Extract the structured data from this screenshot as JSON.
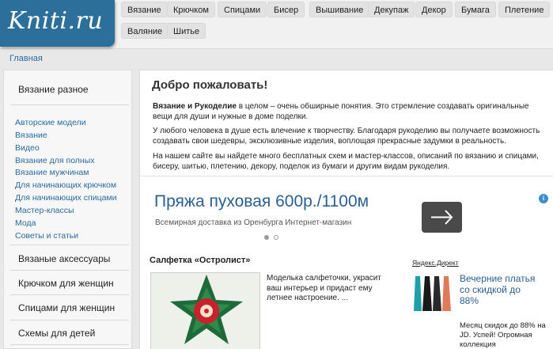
{
  "logo": {
    "text": "Kniti.ru"
  },
  "top_menu": [
    "Вязание",
    "Крючком",
    "Спицами",
    "Бисер",
    "Вышивание",
    "Декупаж",
    "Декор",
    "Бумага",
    "Плетение",
    "Валяние",
    "Шитье"
  ],
  "breadcrumb": {
    "home": "Главная"
  },
  "sidebar": {
    "sections": [
      "Вязание разное",
      "Вязаные аксессуары",
      "Крючком для женщин",
      "Спицами для женщин",
      "Схемы для детей"
    ],
    "links": [
      "Авторские модели",
      "Вязание",
      "Видео",
      "Вязание для полных",
      "Вязание мужчинам",
      "Для начинающих крючком",
      "Для начинающих спицами",
      "Мастер-классы",
      "Мода",
      "Советы и статьи"
    ]
  },
  "main": {
    "title": "Добро пожаловать!",
    "para1_bold": "Вязание и Рукоделие",
    "para1_rest": " в целом – очень обширные понятия. Это стремление создавать оригинальные вещи для души и нужные в доме поделки.",
    "para2": "У любого человека в душе есть влечение к творчеству. Благодаря рукоделию вы получаете возможность создавать свои шедевры, эксклюзивные изделия, воплощая прекрасные задумки в реальность.",
    "para3": "На нашем сайте вы найдете много бесплатных схем и мастер-классов, описаний по вязанию и спицами, бисеру, шитью, плетению, декору, поделок из бумаги и другим видам рукоделия."
  },
  "ad_banner": {
    "title": "Пряжа пуховая 600р./1100м",
    "subtitle": "Всемирная доставка из Оренбурга Интернет-магазин",
    "info": "i"
  },
  "article": {
    "title": "Салфетка «Остролист»",
    "text": "Моделька салфеточки, украсит ваш интерьер и придаст ему летнее настроение. ..."
  },
  "yandex_ad": {
    "label": "Яндекс.Директ",
    "title": "Вечерние платья со скидкой до 88%",
    "text": "Месяц скидок до 88% на JD. Успей! Огромная коллекция"
  },
  "colors": {
    "brand": "#2b6f9a",
    "link": "#2a6a9e",
    "ad_title": "#2a5f93"
  }
}
